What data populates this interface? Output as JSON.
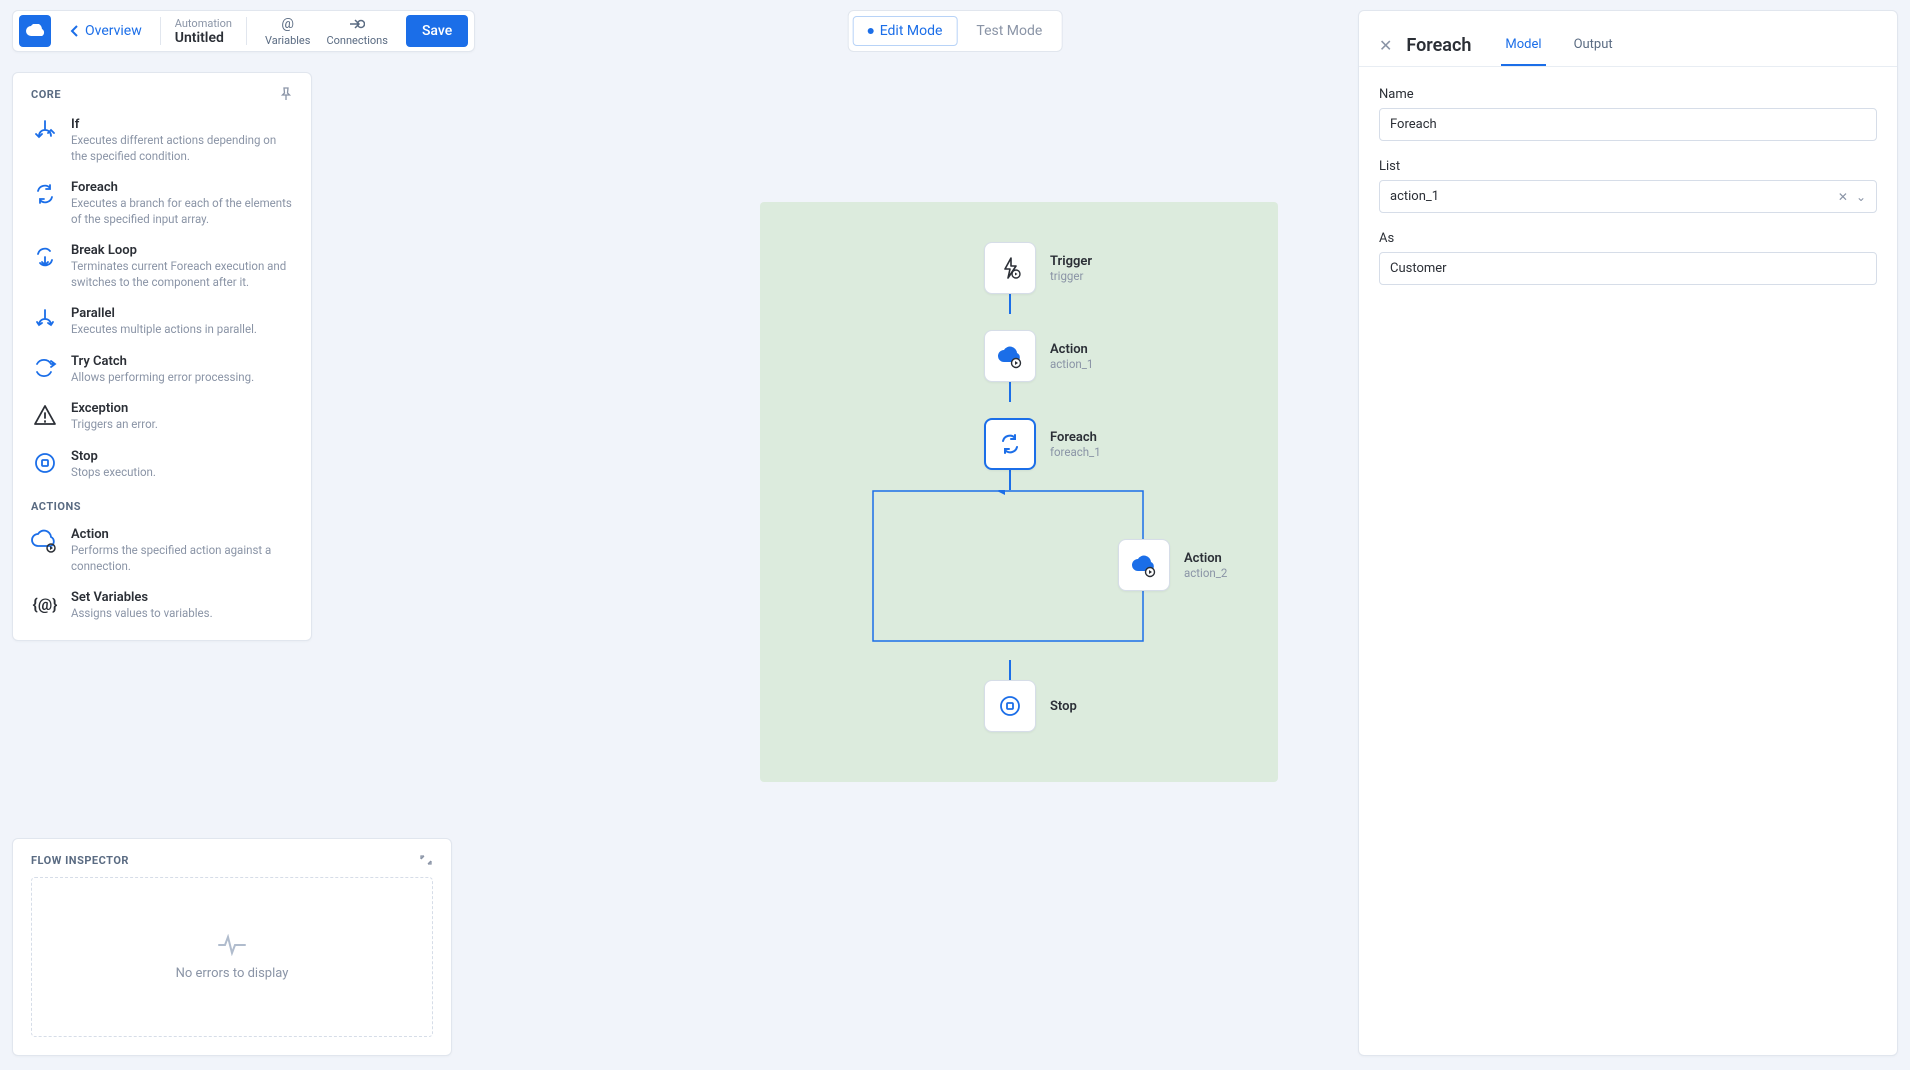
{
  "topbar": {
    "overview_label": "Overview",
    "automation_caption": "Automation",
    "automation_name": "Untitled",
    "variables_label": "Variables",
    "connections_label": "Connections",
    "save_label": "Save"
  },
  "mode": {
    "edit_label": "Edit Mode",
    "test_label": "Test Mode"
  },
  "palette": {
    "core_label": "CORE",
    "actions_label": "ACTIONS",
    "core_items": [
      {
        "title": "If",
        "desc": "Executes different actions depending on the specified condition."
      },
      {
        "title": "Foreach",
        "desc": "Executes a branch for each of the elements of the specified input array."
      },
      {
        "title": "Break Loop",
        "desc": "Terminates current Foreach execution and switches to the component after it."
      },
      {
        "title": "Parallel",
        "desc": "Executes multiple actions in parallel."
      },
      {
        "title": "Try Catch",
        "desc": "Allows performing error processing."
      },
      {
        "title": "Exception",
        "desc": "Triggers an error."
      },
      {
        "title": "Stop",
        "desc": "Stops execution."
      }
    ],
    "action_items": [
      {
        "title": "Action",
        "desc": "Performs the specified action against a connection."
      },
      {
        "title": "Set Variables",
        "desc": "Assigns values to variables."
      }
    ]
  },
  "inspector": {
    "title": "FLOW INSPECTOR",
    "empty_message": "No errors to display"
  },
  "flow": {
    "nodes": [
      {
        "title": "Trigger",
        "sub": "trigger"
      },
      {
        "title": "Action",
        "sub": "action_1"
      },
      {
        "title": "Foreach",
        "sub": "foreach_1"
      },
      {
        "title": "Action",
        "sub": "action_2"
      },
      {
        "title": "Stop",
        "sub": ""
      }
    ]
  },
  "rpanel": {
    "title": "Foreach",
    "tab_model": "Model",
    "tab_output": "Output",
    "name_label": "Name",
    "name_value": "Foreach",
    "list_label": "List",
    "list_value": "action_1",
    "as_label": "As",
    "as_value": "Customer"
  }
}
